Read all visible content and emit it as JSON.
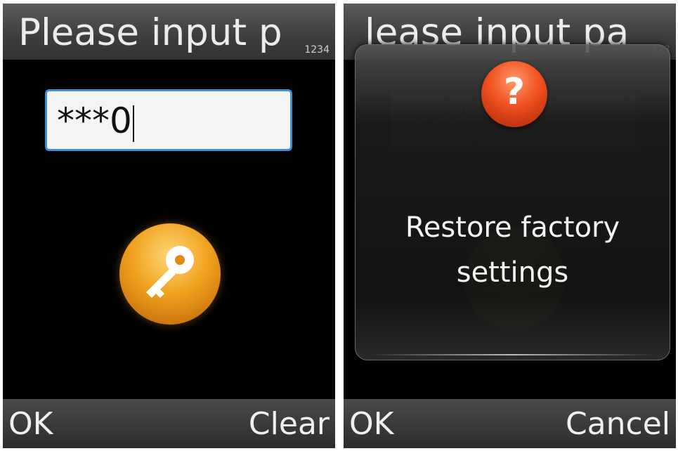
{
  "left_screen": {
    "title": "Please input p",
    "input_mode": "1234",
    "password_field": {
      "value": "***0"
    },
    "icon": "key-icon",
    "softkeys": {
      "left": "OK",
      "right": "Clear"
    }
  },
  "right_screen": {
    "background_title": "lease input pa",
    "background_input_mode": "123",
    "background_password": "****",
    "dialog": {
      "icon": "question-icon",
      "icon_symbol": "?",
      "message": "Restore factory settings"
    },
    "softkeys": {
      "left": "OK",
      "right": "Cancel"
    }
  },
  "colors": {
    "titlebar": "#444444",
    "input_border": "#3d8fd8",
    "key_icon": "#f0a21e",
    "question_icon": "#f0501e"
  }
}
